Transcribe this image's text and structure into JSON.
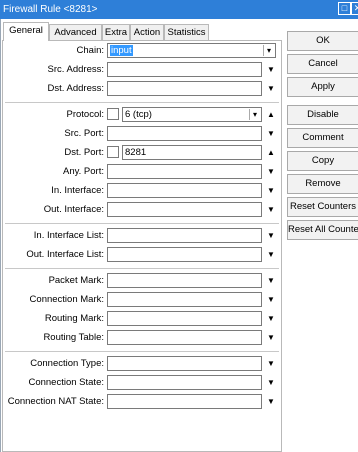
{
  "window": {
    "title": "Firewall Rule <8281>"
  },
  "tabs": [
    "General",
    "Advanced",
    "Extra",
    "Action",
    "Statistics"
  ],
  "fields": {
    "chain": {
      "label": "Chain:",
      "value": "input"
    },
    "src_address": {
      "label": "Src. Address:"
    },
    "dst_address": {
      "label": "Dst. Address:"
    },
    "protocol": {
      "label": "Protocol:",
      "value": "6 (tcp)"
    },
    "src_port": {
      "label": "Src. Port:"
    },
    "dst_port": {
      "label": "Dst. Port:",
      "value": "8281"
    },
    "any_port": {
      "label": "Any. Port:"
    },
    "in_interface": {
      "label": "In. Interface:"
    },
    "out_interface": {
      "label": "Out. Interface:"
    },
    "in_interface_list": {
      "label": "In. Interface List:"
    },
    "out_interface_list": {
      "label": "Out. Interface List:"
    },
    "packet_mark": {
      "label": "Packet Mark:"
    },
    "connection_mark": {
      "label": "Connection Mark:"
    },
    "routing_mark": {
      "label": "Routing Mark:"
    },
    "routing_table": {
      "label": "Routing Table:"
    },
    "connection_type": {
      "label": "Connection Type:"
    },
    "connection_state": {
      "label": "Connection State:"
    },
    "connection_nat_state": {
      "label": "Connection NAT State:"
    }
  },
  "buttons": {
    "ok": "OK",
    "cancel": "Cancel",
    "apply": "Apply",
    "disable": "Disable",
    "comment": "Comment",
    "copy": "Copy",
    "remove": "Remove",
    "reset_counters": "Reset Counters",
    "reset_all_counters": "Reset All Counters"
  },
  "icons": {
    "dropdown": "triangle-down-icon",
    "expand": "triangle-up-icon",
    "maximize": "maximize-icon",
    "close": "close-icon"
  }
}
